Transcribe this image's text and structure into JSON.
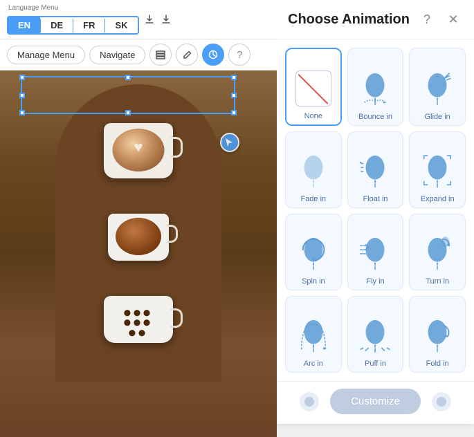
{
  "left": {
    "lang_menu_label": "Language Menu",
    "tabs": [
      {
        "id": "EN",
        "label": "EN",
        "active": true
      },
      {
        "id": "DE",
        "label": "DE",
        "active": false
      },
      {
        "id": "FR",
        "label": "FR",
        "active": false
      },
      {
        "id": "SK",
        "label": "SK",
        "active": false
      }
    ],
    "toolbar": {
      "manage_label": "Manage Menu",
      "navigate_label": "Navigate"
    }
  },
  "panel": {
    "title": "Choose Animation",
    "help_icon": "?",
    "close_icon": "✕",
    "animations": [
      {
        "id": "none",
        "label": "None",
        "type": "none"
      },
      {
        "id": "bounce-in",
        "label": "Bounce in",
        "type": "bounce"
      },
      {
        "id": "glide-in",
        "label": "Glide in",
        "type": "glide"
      },
      {
        "id": "fade-in",
        "label": "Fade in",
        "type": "fade"
      },
      {
        "id": "float-in",
        "label": "Float in",
        "type": "float"
      },
      {
        "id": "expand-in",
        "label": "Expand in",
        "type": "expand"
      },
      {
        "id": "spin-in",
        "label": "Spin in",
        "type": "spin"
      },
      {
        "id": "fly-in",
        "label": "Fly in",
        "type": "fly"
      },
      {
        "id": "turn-in",
        "label": "Turn in",
        "type": "turn"
      },
      {
        "id": "arc-in",
        "label": "Arc in",
        "type": "arc"
      },
      {
        "id": "puff-in",
        "label": "Puff in",
        "type": "puff"
      },
      {
        "id": "fold-in",
        "label": "Fold in",
        "type": "fold"
      }
    ],
    "customize_label": "Customize"
  }
}
